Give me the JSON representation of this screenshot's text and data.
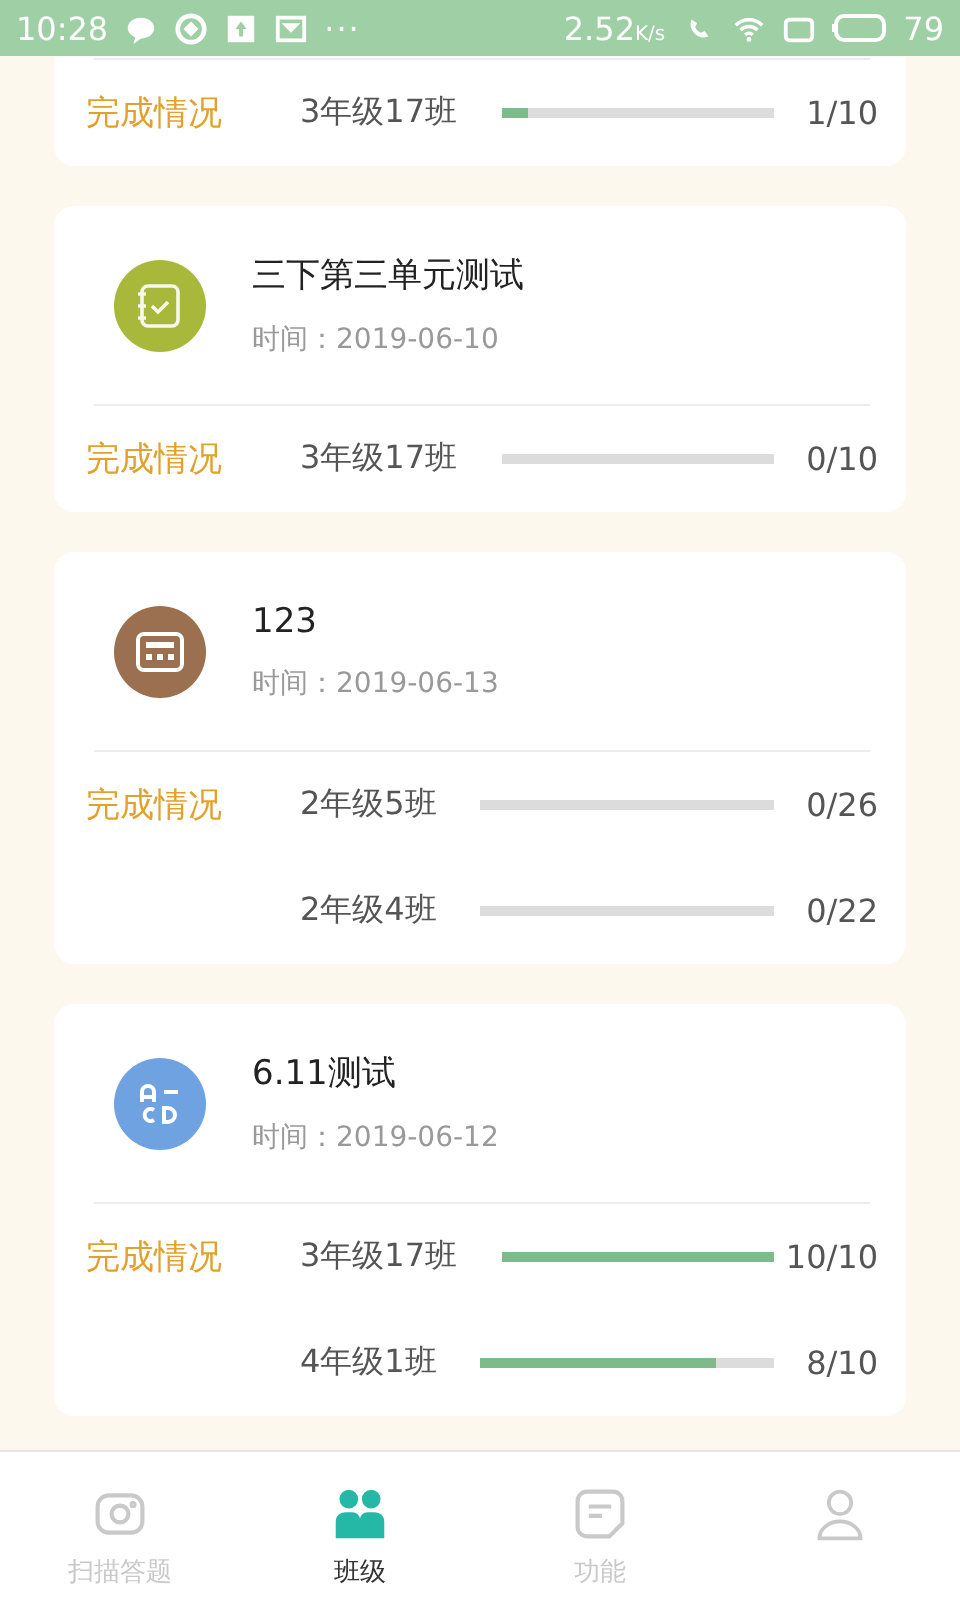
{
  "status_bar": {
    "time": "10:28",
    "more": "···",
    "net_speed": "2.52",
    "net_unit": "K/s",
    "battery": "79"
  },
  "cards": [
    {
      "rows": [
        {
          "label": "完成情况",
          "class": "3年级17班",
          "level": 0.1,
          "count": "1/10"
        }
      ]
    },
    {
      "title": "三下第三单元测试",
      "date": "时间：2019-06-10",
      "kind": "notebook",
      "color": "#a8b83a",
      "rows": [
        {
          "label": "完成情况",
          "class": "3年级17班",
          "level": 0,
          "count": "0/10"
        }
      ]
    },
    {
      "title": "123",
      "date": "时间：2019-06-13",
      "kind": "calculator",
      "color": "#9a7050",
      "rows": [
        {
          "label": "完成情况",
          "class": "2年级5班",
          "level": 0,
          "count": "0/26"
        },
        {
          "class": "2年级4班",
          "level": 0,
          "count": "0/22"
        }
      ]
    },
    {
      "title": "6.11测试",
      "date": "时间：2019-06-12",
      "kind": "letters",
      "color": "#6ea2e0",
      "rows": [
        {
          "label": "完成情况",
          "class": "3年级17班",
          "level": 1,
          "count": "10/10"
        },
        {
          "class": "4年级1班",
          "level": 0.8,
          "count": "8/10"
        }
      ]
    }
  ],
  "tabs": [
    {
      "kind": "camera",
      "label": "扫描答题",
      "selected": false
    },
    {
      "kind": "people",
      "label": "班级",
      "selected": true
    },
    {
      "kind": "note",
      "label": "功能",
      "selected": false
    },
    {
      "kind": "person",
      "selected": false
    }
  ]
}
